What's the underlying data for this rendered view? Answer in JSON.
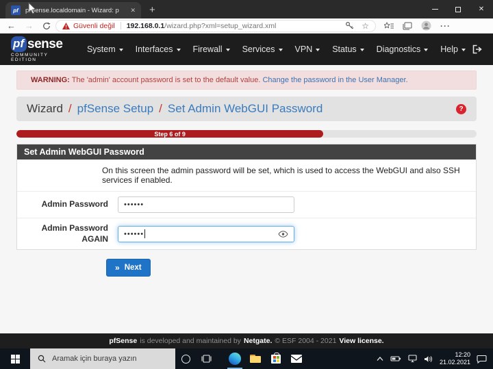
{
  "browser": {
    "tab_title": "pfSense.localdomain - Wizard: p",
    "favicon_text": "pf",
    "security_warning": "Güvenli değil",
    "url_host": "192.168.0.1",
    "url_path": "/wizard.php?xml=setup_wizard.xml"
  },
  "icons": {
    "new_tab": "+",
    "tab_close": "✕",
    "window_close": "✕",
    "back": "←",
    "forward": "→",
    "star": "☆",
    "more": "···",
    "help": "?",
    "breadcrumb_separator": "/",
    "next_chevrons": "»"
  },
  "header": {
    "brand_pf": "pf",
    "brand_sense": "sense",
    "brand_edition": "COMMUNITY EDITION",
    "nav": [
      "System",
      "Interfaces",
      "Firewall",
      "Services",
      "VPN",
      "Status",
      "Diagnostics",
      "Help"
    ]
  },
  "warning": {
    "prefix": "WARNING:",
    "text": "The 'admin' account password is set to the default value.",
    "link": "Change the password in the User Manager."
  },
  "breadcrumb": {
    "root": "Wizard",
    "setup": "pfSense Setup",
    "current": "Set Admin WebGUI Password"
  },
  "progress": {
    "label": "Step 6 of 9",
    "percent": 66.7
  },
  "panel": {
    "title": "Set Admin WebGUI Password",
    "description": "On this screen the admin password will be set, which is used to access the WebGUI and also SSH services if enabled.",
    "password_label": "Admin Password",
    "password_value": "••••••",
    "confirm_label": "Admin Password AGAIN",
    "confirm_value": "••••••",
    "next_label": "Next"
  },
  "footer": {
    "brand": "pfSense",
    "middle": "is developed and maintained by",
    "netgate": "Netgate.",
    "copyright": "© ESF 2004 - 2021",
    "license": "View license."
  },
  "taskbar": {
    "search_placeholder": "Aramak için buraya yazın",
    "time": "12:20",
    "date": "21.02.2021"
  },
  "colors": {
    "pfsense_blue": "#2b55a8",
    "progress_red": "#ad1d1f",
    "link_blue": "#3a7bbd",
    "primary_button": "#1f74c8",
    "alert_bg": "#f2dede"
  }
}
